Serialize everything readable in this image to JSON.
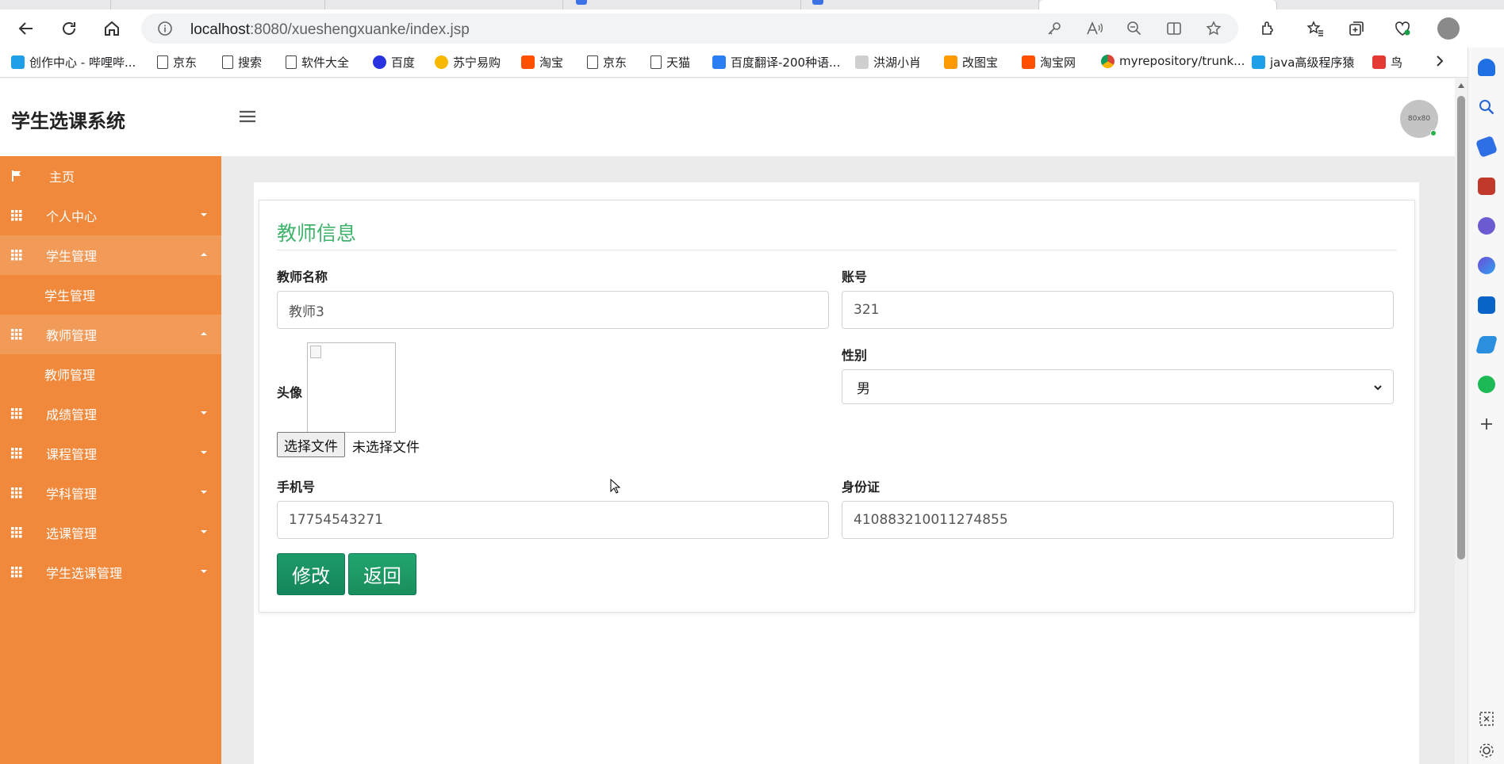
{
  "browser": {
    "url_host": "localhost",
    "url_path": ":8080/xueshengxuanke/index.jsp",
    "bookmarks": [
      {
        "label": "创作中心 - 哔哩哔...",
        "icon": "bilibili-icon",
        "color": "#1e9fe8"
      },
      {
        "label": "京东",
        "icon": "document-icon"
      },
      {
        "label": "搜索",
        "icon": "document-icon"
      },
      {
        "label": "软件大全",
        "icon": "document-icon"
      },
      {
        "label": "百度",
        "icon": "baidu-icon",
        "color": "#2932e1"
      },
      {
        "label": "苏宁易购",
        "icon": "suning-icon",
        "color": "#f9b800"
      },
      {
        "label": "淘宝",
        "icon": "taobao-icon",
        "color": "#ff5000"
      },
      {
        "label": "京东",
        "icon": "document-icon"
      },
      {
        "label": "天猫",
        "icon": "document-icon"
      },
      {
        "label": "百度翻译-200种语...",
        "icon": "translate-icon",
        "color": "#2a7ef4"
      },
      {
        "label": "洪湖小肖",
        "icon": "bird-icon",
        "color": "#555555"
      },
      {
        "label": "改图宝",
        "icon": "gaitubao-icon",
        "color": "#ff9a00"
      },
      {
        "label": "淘宝网",
        "icon": "taobao-icon",
        "color": "#ff5000"
      },
      {
        "label": "myrepository/trunk...",
        "icon": "chrome-icon",
        "color": "#db4437"
      },
      {
        "label": "java高级程序猿",
        "icon": "bilibili-icon",
        "color": "#1e9fe8"
      },
      {
        "label": "鸟",
        "icon": "bird-icon",
        "color": "#e53935"
      }
    ]
  },
  "app": {
    "title": "学生选课系统",
    "avatar_text": "80x80"
  },
  "nav": {
    "home": "主页",
    "personal": "个人中心",
    "student_mgmt": "学生管理",
    "student_mgmt_sub": "学生管理",
    "teacher_mgmt": "教师管理",
    "teacher_mgmt_sub": "教师管理",
    "grade_mgmt": "成绩管理",
    "course_mgmt": "课程管理",
    "subject_mgmt": "学科管理",
    "selection_mgmt": "选课管理",
    "student_selection_mgmt": "学生选课管理"
  },
  "form": {
    "title": "教师信息",
    "name_label": "教师名称",
    "name_value": "教师3",
    "account_label": "账号",
    "account_value": "321",
    "avatar_label": "头像",
    "file_button": "选择文件",
    "file_status": "未选择文件",
    "gender_label": "性别",
    "gender_value": "男",
    "phone_label": "手机号",
    "phone_value": "17754543271",
    "idcard_label": "身份证",
    "idcard_value": "410883210011274855",
    "submit_label": "修改",
    "back_label": "返回"
  },
  "colors": {
    "sidebar": "#f0893c",
    "accent_green": "#3fb36b",
    "button_green": "#14855a"
  }
}
